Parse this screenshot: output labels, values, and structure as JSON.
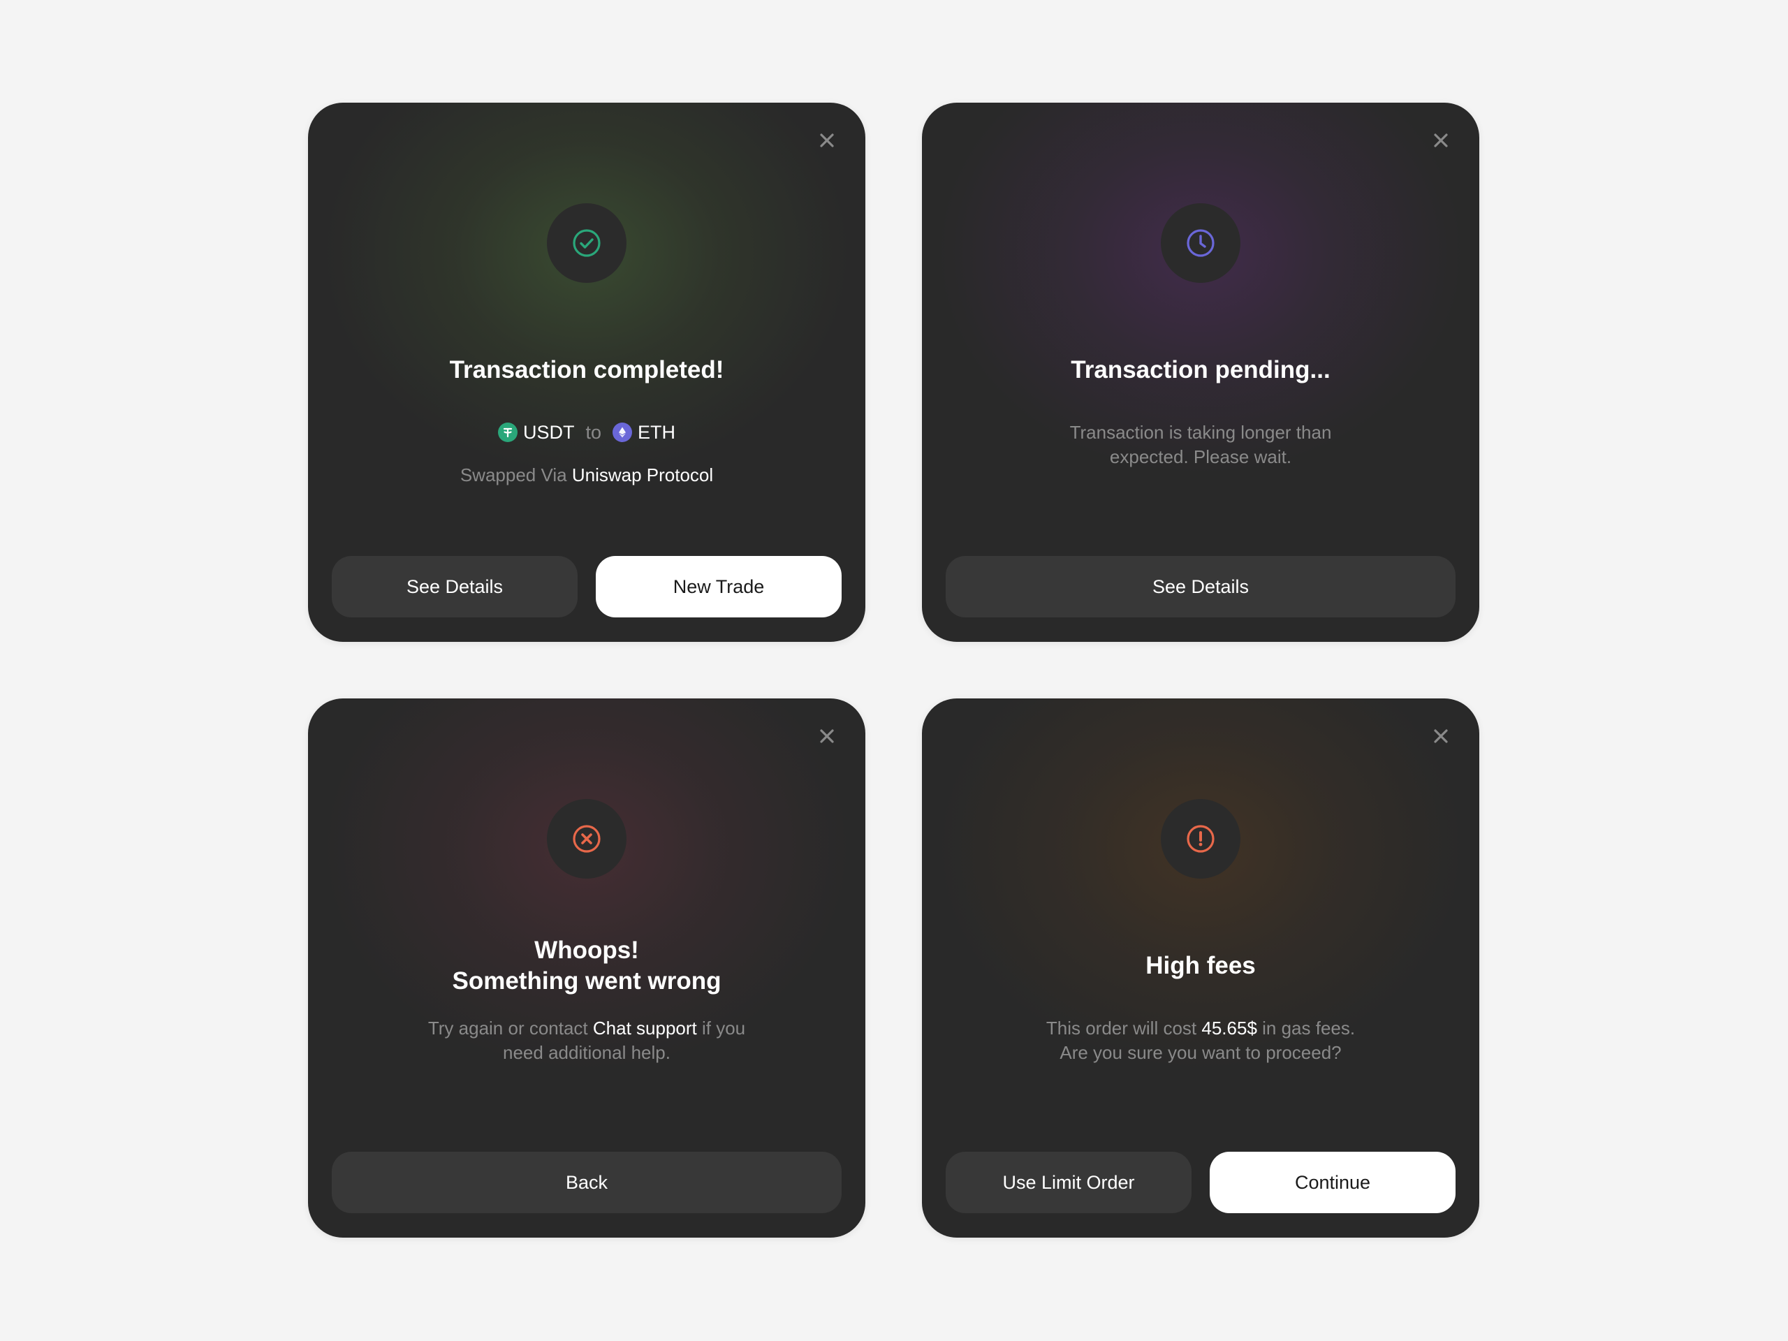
{
  "cards": {
    "success": {
      "status_icon": "check-circle-icon",
      "accent_color": "#2aa77a",
      "title": "Transaction completed!",
      "from_token": {
        "symbol": "USDT",
        "icon": "tether-icon",
        "color": "#2aa77a"
      },
      "connector": "to",
      "to_token": {
        "symbol": "ETH",
        "icon": "ethereum-icon",
        "color": "#6a67d8"
      },
      "via_prefix": "Swapped Via",
      "via_protocol": "Uniswap Protocol",
      "buttons": {
        "secondary": "See Details",
        "primary": "New Trade"
      }
    },
    "pending": {
      "status_icon": "clock-icon",
      "accent_color": "#6a67d8",
      "title": "Transaction pending...",
      "message_line1": "Transaction is taking longer than",
      "message_line2": "expected. Please wait.",
      "buttons": {
        "secondary": "See Details"
      }
    },
    "error": {
      "status_icon": "x-circle-icon",
      "accent_color": "#e8684a",
      "title_line1": "Whoops!",
      "title_line2": "Something went wrong",
      "message_prefix": "Try again or contact",
      "message_link": "Chat support",
      "message_suffix": "if you",
      "message_line2": "need additional help.",
      "buttons": {
        "secondary": "Back"
      }
    },
    "warning": {
      "status_icon": "exclamation-circle-icon",
      "accent_color": "#e8684a",
      "title": "High fees",
      "message_prefix": "This order will cost",
      "fee_amount": "45.65$",
      "message_suffix": "in gas fees.",
      "message_line2": "Are you sure you want to proceed?",
      "buttons": {
        "secondary": "Use Limit Order",
        "primary": "Continue"
      }
    }
  },
  "close_icon": "close-icon"
}
